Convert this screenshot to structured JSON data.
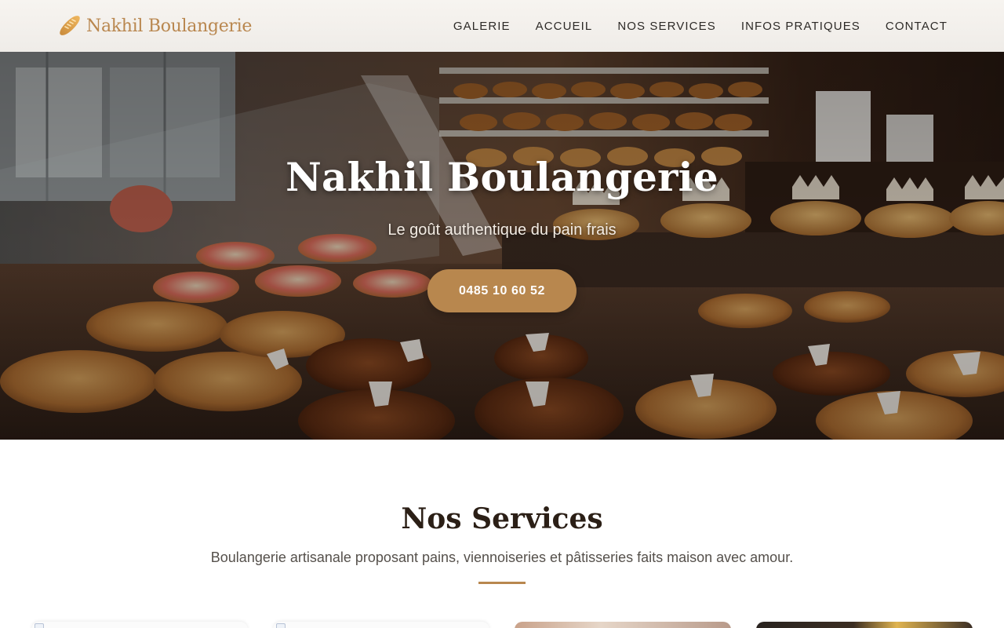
{
  "brand": {
    "name": "Nakhil Boulangerie",
    "icon": "baguette-icon"
  },
  "nav": {
    "items": [
      "GALERIE",
      "ACCUEIL",
      "NOS SERVICES",
      "INFOS PRATIQUES",
      "CONTACT"
    ]
  },
  "hero": {
    "title": "Nakhil Boulangerie",
    "subtitle": "Le goût authentique du pain frais",
    "cta_label": "0485 10 60 52"
  },
  "services": {
    "title": "Nos Services",
    "description": "Boulangerie artisanale proposant pains, viennoiseries et pâtisseries faits maison avec amour."
  },
  "colors": {
    "accent": "#b8874e",
    "brand_text": "#b9874f",
    "heading": "#2b1f16",
    "nav_text": "#2d2a27"
  }
}
